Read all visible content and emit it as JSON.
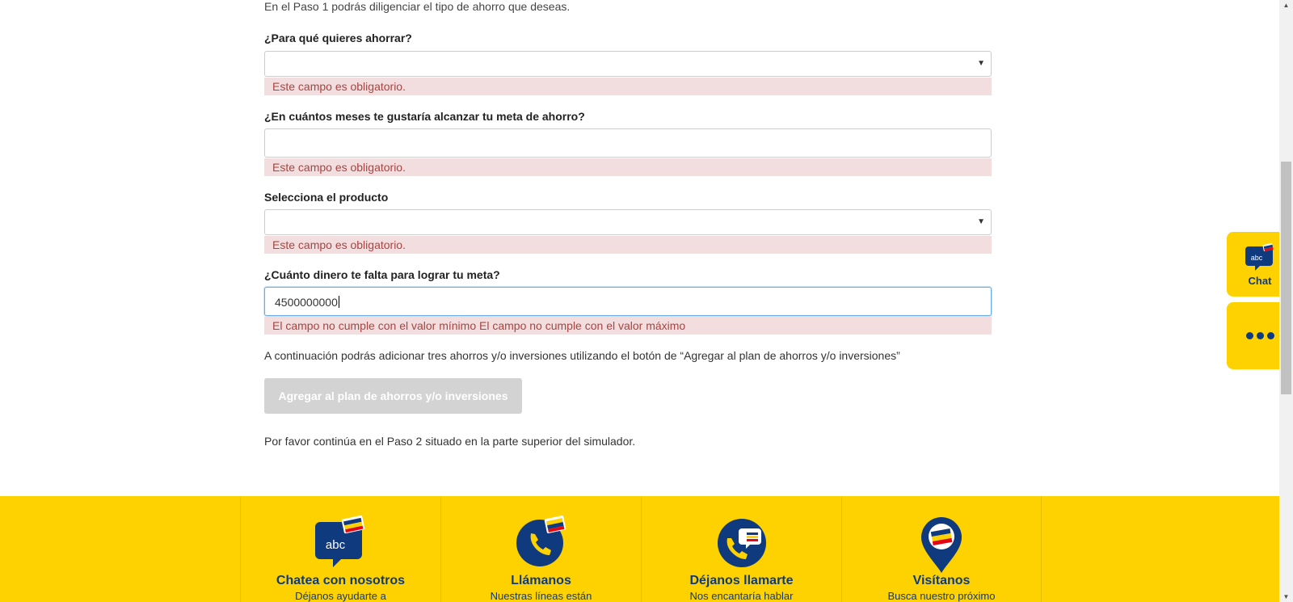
{
  "form": {
    "intro": "En el Paso 1 podrás diligenciar el tipo de ahorro que deseas.",
    "q1": {
      "label": "¿Para qué quieres ahorrar?",
      "value": "",
      "error": "Este campo es obligatorio."
    },
    "q2": {
      "label": "¿En cuántos meses te gustaría alcanzar tu meta de ahorro?",
      "value": "",
      "error": "Este campo es obligatorio."
    },
    "q3": {
      "label": "Selecciona el producto",
      "value": "",
      "error": "Este campo es obligatorio."
    },
    "q4": {
      "label": "¿Cuánto dinero te falta para lograr tu meta?",
      "value": "4500000000",
      "error": "El campo no cumple con el valor mínimo El campo no cumple con el valor máximo"
    },
    "help_text": "A continuación podrás adicionar tres ahorros y/o inversiones utilizando el botón de “Agregar al plan de ahorros y/o inversiones”",
    "add_button": "Agregar al plan de ahorros y/o inversiones",
    "continue_text": "Por favor continúa en el Paso 2 situado en la parte superior del simulador."
  },
  "widget": {
    "chat_label": "Chat",
    "icon_text": "abc"
  },
  "footer": {
    "items": [
      {
        "title": "Chatea con nosotros",
        "subtitle": "Déjanos ayudarte a",
        "icon": "chat-bubble-icon"
      },
      {
        "title": "Llámanos",
        "subtitle": "Nuestras líneas están",
        "icon": "phone-icon"
      },
      {
        "title": "Déjanos llamarte",
        "subtitle": "Nos encantaría hablar",
        "icon": "callback-icon"
      },
      {
        "title": "Visítanos",
        "subtitle": "Busca nuestro próximo",
        "icon": "map-pin-icon"
      }
    ]
  },
  "colors": {
    "brand_yellow": "#fed100",
    "brand_blue": "#0f3a7d",
    "error_bg": "#f2dede",
    "error_text": "#a94442"
  }
}
